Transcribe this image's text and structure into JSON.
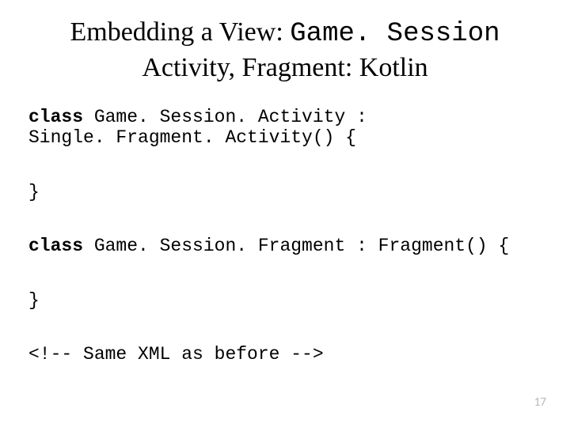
{
  "title": {
    "line1_prefix": "Embedding a View: ",
    "line1_mono": "Game. Session",
    "line2": "Activity, Fragment: Kotlin"
  },
  "code": {
    "kw_class": "class",
    "block1_line1_rest": " Game. Session. Activity :",
    "block1_line2": "Single. Fragment. Activity() {",
    "close_brace": "}",
    "block2_line1_rest": " Game. Session. Fragment : Fragment() {",
    "comment": "<!-- Same XML as before -->"
  },
  "page_number": "17"
}
